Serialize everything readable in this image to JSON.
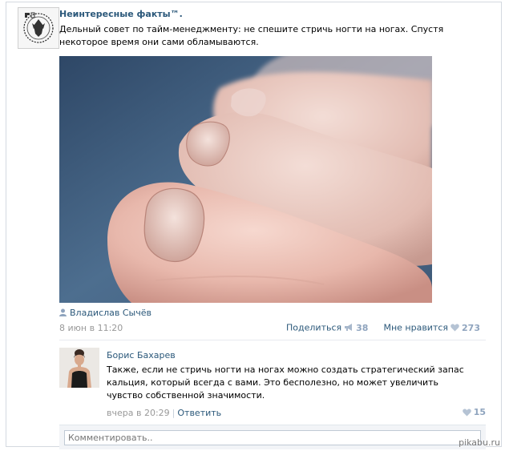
{
  "post": {
    "group_name": "Неинтересные факты™.",
    "text": "Дельный совет по тайм-менеджменту: не спешите стричь ногти на ногах. Спустя некоторое время они сами обламываются.",
    "author": "Владислав Сычёв",
    "date": "8 июн в 11:20",
    "share_label": "Поделиться",
    "share_count": "38",
    "like_label": "Мне нравится",
    "like_count": "273"
  },
  "comment": {
    "author": "Борис Бахарев",
    "text": "Также, если не стричь ногти на ногах можно создать стратегический запас кальция, который всегда с вами. Это бесполезно, но может увеличить чувство собственной значимости.",
    "time": "вчера в 20:29",
    "separator": "|",
    "reply_label": "Ответить",
    "like_count": "15"
  },
  "comment_input": {
    "placeholder": "Комментировать.."
  },
  "watermark": "pikabu.ru",
  "colors": {
    "link": "#2b587a",
    "muted": "#999999",
    "count": "#8fa4be"
  },
  "icons": {
    "author": "person-icon",
    "share": "megaphone-icon",
    "like": "heart-icon"
  }
}
